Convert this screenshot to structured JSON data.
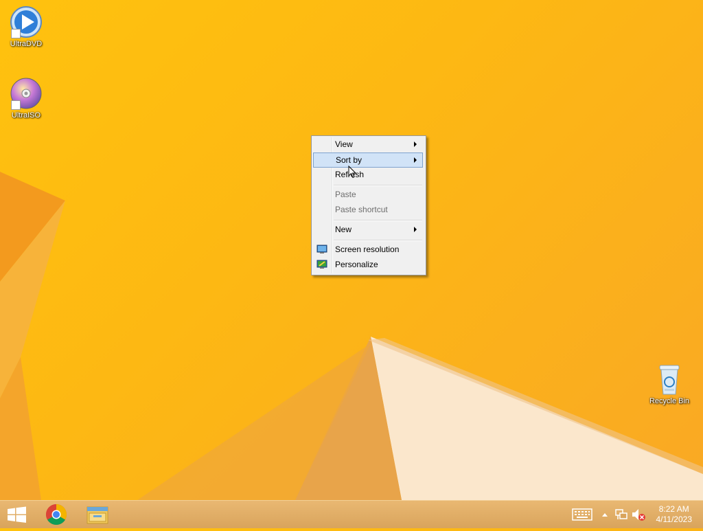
{
  "desktop": {
    "icons": [
      {
        "label": "UltraDVD",
        "icon": "ultradvd-icon"
      },
      {
        "label": "UltraISO",
        "icon": "ultraiso-icon"
      },
      {
        "label": "Recycle Bin",
        "icon": "recycle-bin-icon"
      }
    ]
  },
  "context_menu": {
    "items": [
      {
        "label": "View",
        "submenu": true,
        "enabled": true
      },
      {
        "label": "Sort by",
        "submenu": true,
        "enabled": true,
        "highlighted": true
      },
      {
        "label": "Refresh",
        "submenu": false,
        "enabled": true
      },
      {
        "label": "Paste",
        "submenu": false,
        "enabled": false
      },
      {
        "label": "Paste shortcut",
        "submenu": false,
        "enabled": false
      },
      {
        "label": "New",
        "submenu": true,
        "enabled": true
      },
      {
        "label": "Screen resolution",
        "submenu": false,
        "enabled": true,
        "icon": "monitor-icon"
      },
      {
        "label": "Personalize",
        "submenu": false,
        "enabled": true,
        "icon": "personalize-icon"
      }
    ]
  },
  "taskbar": {
    "pinned": [
      {
        "name": "Start",
        "icon": "windows-logo-icon"
      },
      {
        "name": "Google Chrome",
        "icon": "chrome-icon"
      },
      {
        "name": "File Explorer",
        "icon": "file-explorer-icon"
      }
    ],
    "tray_icons": [
      "keyboard-icon",
      "show-hidden-icons-chevron",
      "network-icon",
      "volume-muted-icon"
    ],
    "clock": {
      "time": "8:22 AM",
      "date": "4/11/2023"
    }
  },
  "colors": {
    "wallpaper": "#fdb813",
    "menu_bg": "#f0f0f0",
    "menu_highlight": "#d1e3f7",
    "menu_highlight_border": "#7da2ce"
  }
}
